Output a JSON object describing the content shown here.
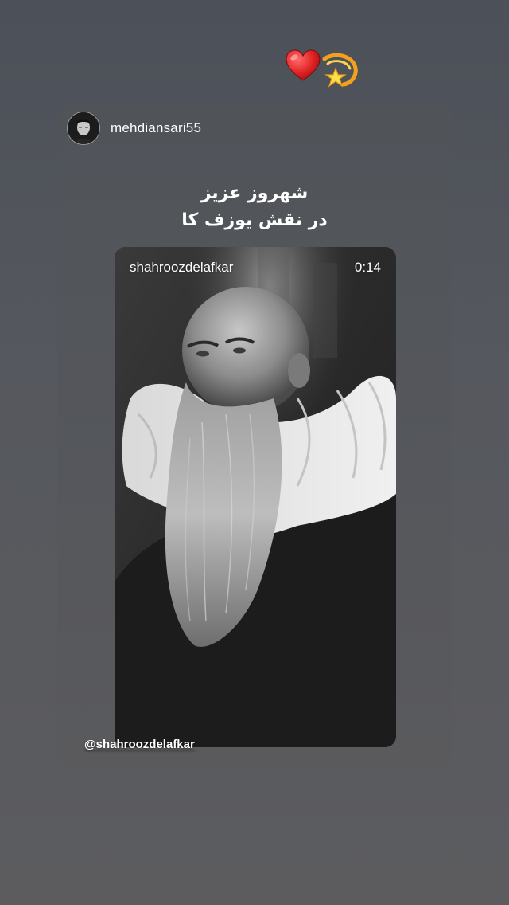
{
  "stickers": {
    "emoji": [
      "red-heart",
      "dizzy-star"
    ]
  },
  "shared_post": {
    "author": "mehdiansari55",
    "caption_line1": "شهروز عزیز",
    "caption_line2": "در نقش یوزف کا"
  },
  "embedded_video": {
    "account": "shahroozdelafkar",
    "duration": "0:14"
  },
  "mention": {
    "text": "@shahroozdelafkar"
  }
}
